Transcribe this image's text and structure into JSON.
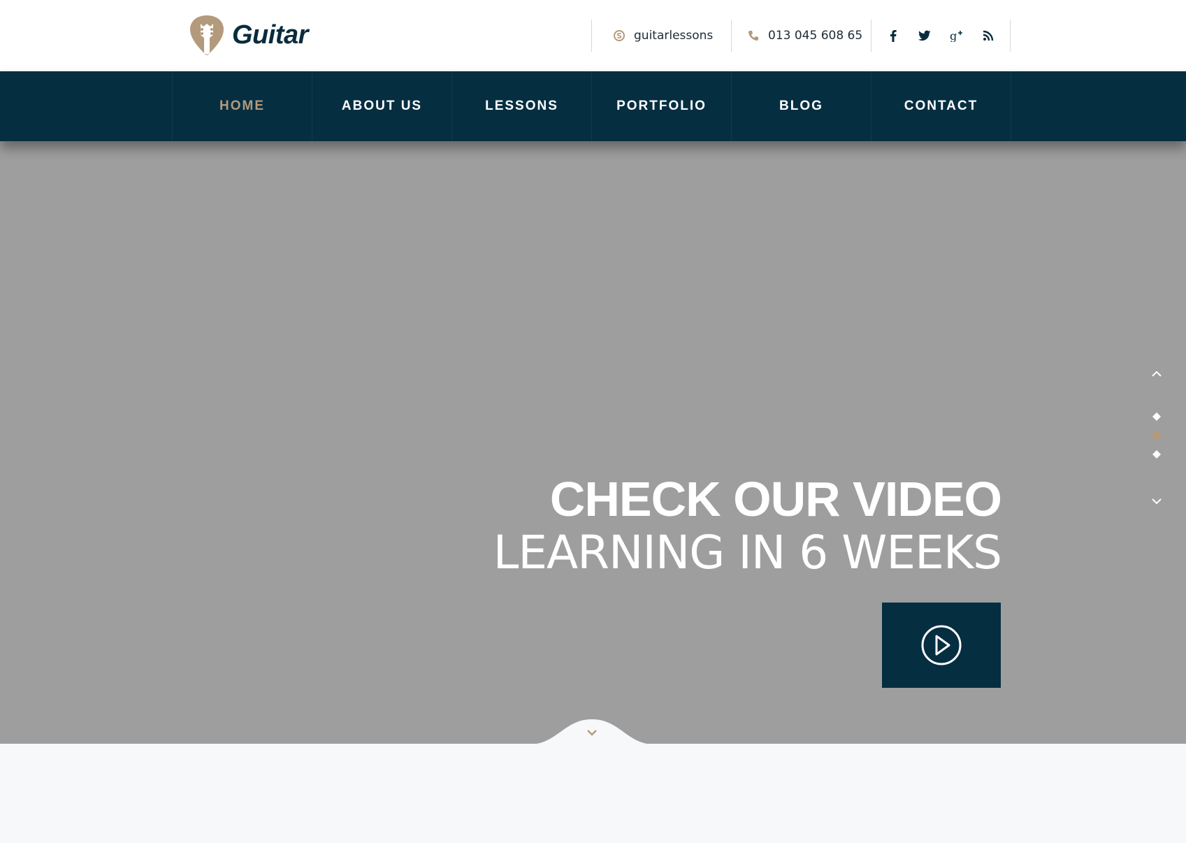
{
  "brand": {
    "name": "Guitar",
    "accent_color": "#b39a7c",
    "dark_color": "#062e41"
  },
  "header": {
    "skype": {
      "icon": "skype-icon",
      "text": "guitarlessons"
    },
    "phone": {
      "icon": "phone-icon",
      "text": "013 045 608 65"
    },
    "social": [
      {
        "icon": "facebook-icon"
      },
      {
        "icon": "twitter-icon"
      },
      {
        "icon": "google-plus-icon"
      },
      {
        "icon": "rss-icon"
      }
    ]
  },
  "nav": {
    "items": [
      {
        "label": "HOME",
        "active": true
      },
      {
        "label": "ABOUT US",
        "active": false
      },
      {
        "label": "LESSONS",
        "active": false
      },
      {
        "label": "PORTFOLIO",
        "active": false
      },
      {
        "label": "BLOG",
        "active": false
      },
      {
        "label": "CONTACT",
        "active": false
      }
    ]
  },
  "hero": {
    "background_color": "#9e9e9e",
    "title": "CHECK OUR VIDEO",
    "subtitle": "LEARNING IN 6 WEEKS",
    "play_icon": "play-circle-icon",
    "slider": {
      "up_icon": "chevron-up-icon",
      "down_icon": "chevron-down-icon",
      "slide_count": 3,
      "active_slide": 2
    },
    "scroll_icon": "chevron-down-icon"
  }
}
